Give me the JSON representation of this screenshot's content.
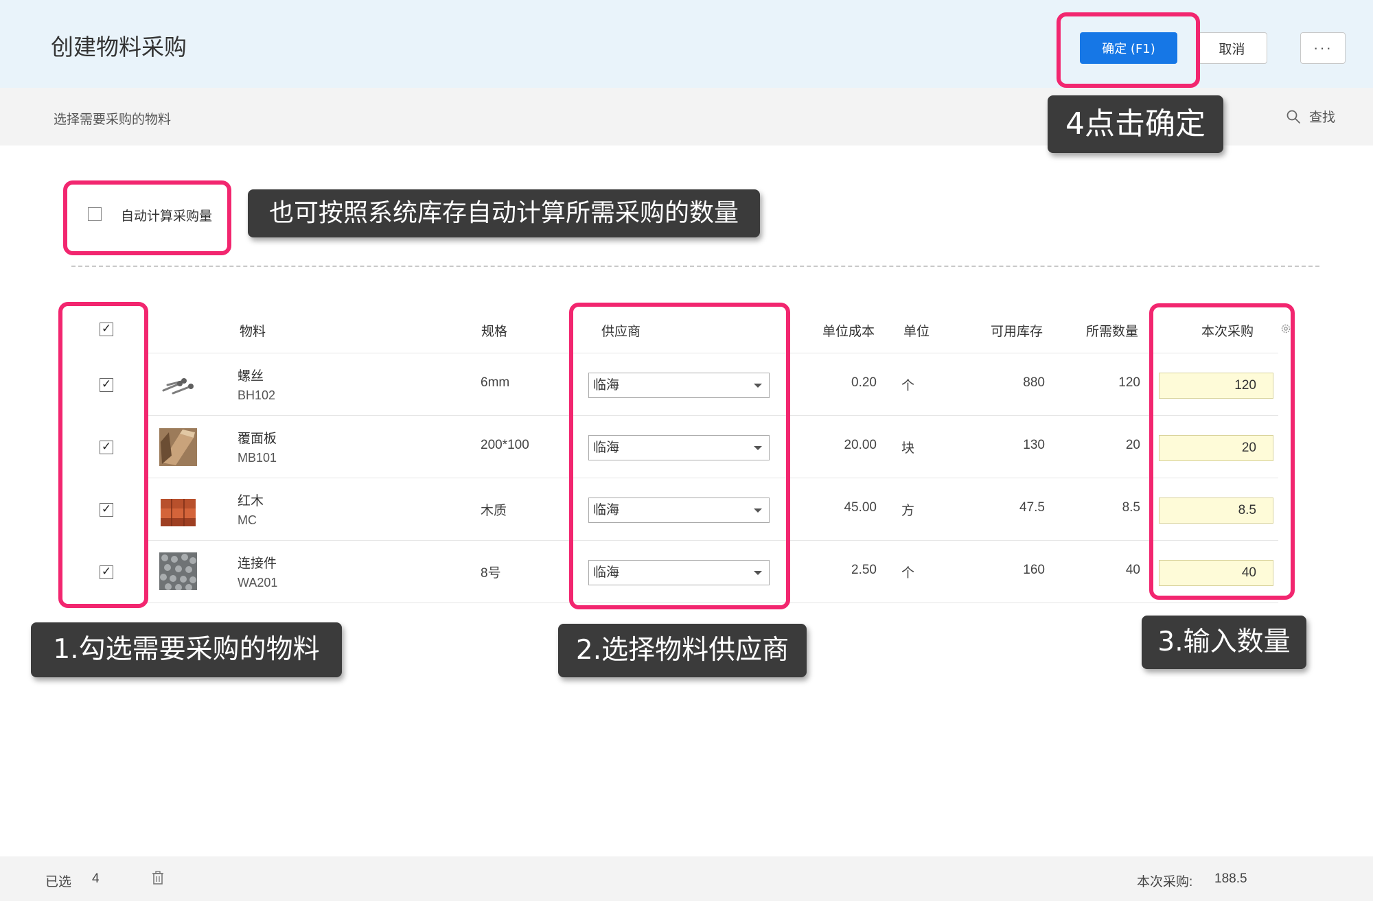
{
  "header": {
    "title": "创建物料采购",
    "confirm_label": "确定 (F1)",
    "cancel_label": "取消",
    "more_label": "···"
  },
  "subheader": {
    "title": "选择需要采购的物料",
    "search_label": "查找"
  },
  "options": {
    "auto_calc_label": "自动计算采购量",
    "auto_calc_checked": false
  },
  "table": {
    "headers": {
      "material": "物料",
      "spec": "规格",
      "supplier": "供应商",
      "unit_cost": "单位成本",
      "unit": "单位",
      "available_stock": "可用库存",
      "required_qty": "所需数量",
      "purchase_qty": "本次采购"
    },
    "header_checked": "✓",
    "rows": [
      {
        "checked": "✓",
        "thumb": "screw",
        "name": "螺丝",
        "code": "BH102",
        "spec": "6mm",
        "supplier": "临海",
        "unit_cost": "0.20",
        "unit": "个",
        "stock": "880",
        "required": "120",
        "purchase": "120"
      },
      {
        "checked": "✓",
        "thumb": "panel",
        "name": "覆面板",
        "code": "MB101",
        "spec": "200*100",
        "supplier": "临海",
        "unit_cost": "20.00",
        "unit": "块",
        "stock": "130",
        "required": "20",
        "purchase": "20"
      },
      {
        "checked": "✓",
        "thumb": "wood",
        "name": "红木",
        "code": "MC",
        "spec": "木质",
        "supplier": "临海",
        "unit_cost": "45.00",
        "unit": "方",
        "stock": "47.5",
        "required": "8.5",
        "purchase": "8.5"
      },
      {
        "checked": "✓",
        "thumb": "connector",
        "name": "连接件",
        "code": "WA201",
        "spec": "8号",
        "supplier": "临海",
        "unit_cost": "2.50",
        "unit": "个",
        "stock": "160",
        "required": "40",
        "purchase": "40"
      }
    ]
  },
  "annotations": {
    "step1": "1.勾选需要采购的物料",
    "step2": "2.选择物料供应商",
    "step3": "3.输入数量",
    "step4": "4点击确定",
    "auto_hint": "也可按照系统库存自动计算所需采购的数量"
  },
  "footer": {
    "selected_label": "已选",
    "selected_count": "4",
    "total_label": "本次采购:",
    "total_value": "188.5"
  },
  "colors": {
    "primary": "#1677e6",
    "highlight": "#f2266f",
    "header_bg": "#e9f3fa",
    "qty_bg": "#fefbd8",
    "note_bg": "#3b3b3b"
  }
}
